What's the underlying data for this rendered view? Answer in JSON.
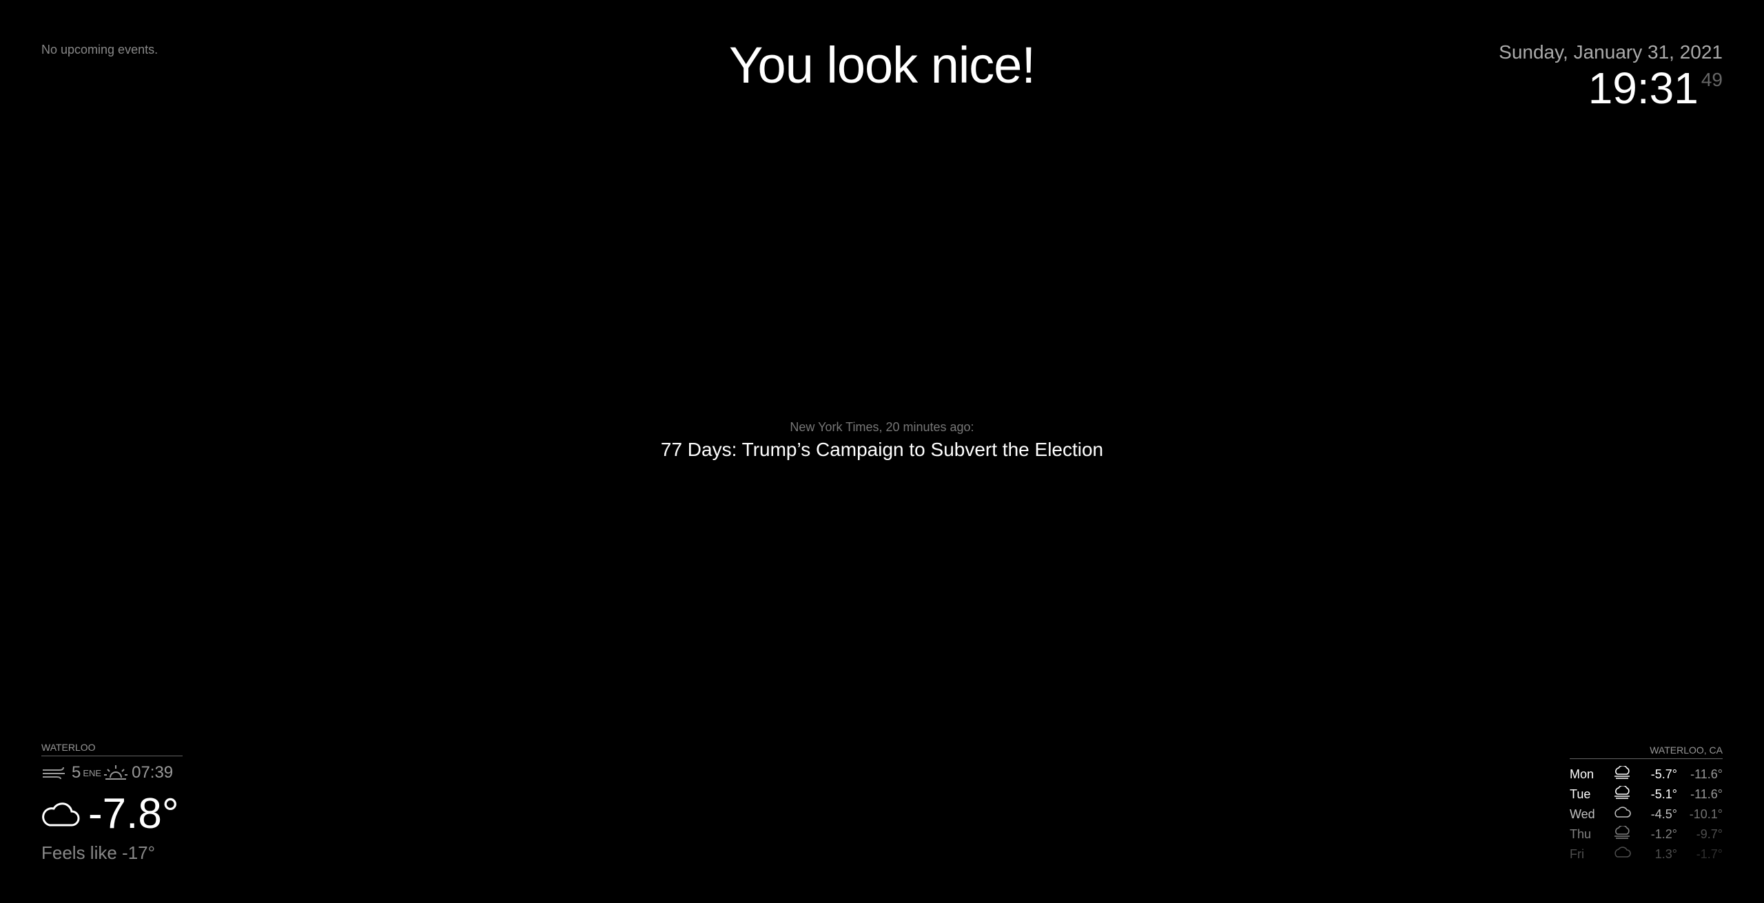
{
  "calendar": {
    "empty_text": "No upcoming events."
  },
  "compliment": {
    "text": "You look nice!"
  },
  "clock": {
    "date": "Sunday, January 31, 2021",
    "hours_minutes": "19:31",
    "seconds": "49"
  },
  "news": {
    "source": "New York Times, 20 minutes ago:",
    "headline": "77 Days: Trump’s Campaign to Subvert the Election"
  },
  "current_weather": {
    "location": "WATERLOO",
    "wind_speed": "5",
    "wind_direction": "ENE",
    "sunrise": "07:39",
    "temperature": "-7.8°",
    "feels_like": "Feels like -17°",
    "wind_icon": "wind-icon",
    "sunrise_icon": "sunrise-icon",
    "condition_icon": "cloudy-icon"
  },
  "forecast": {
    "location": "WATERLOO, CA",
    "days": [
      {
        "day": "Mon",
        "icon": "snow-cloud-icon",
        "max": "-5.7°",
        "min": "-11.6°",
        "opacity": 1.0
      },
      {
        "day": "Tue",
        "icon": "snow-cloud-icon",
        "max": "-5.1°",
        "min": "-11.6°",
        "opacity": 1.0
      },
      {
        "day": "Wed",
        "icon": "cloudy-icon",
        "max": "-4.5°",
        "min": "-10.1°",
        "opacity": 0.75
      },
      {
        "day": "Thu",
        "icon": "snow-cloud-icon",
        "max": "-1.2°",
        "min": "-9.7°",
        "opacity": 0.5
      },
      {
        "day": "Fri",
        "icon": "cloudy-icon",
        "max": "1.3°",
        "min": "-1.7°",
        "opacity": 0.3
      }
    ]
  }
}
